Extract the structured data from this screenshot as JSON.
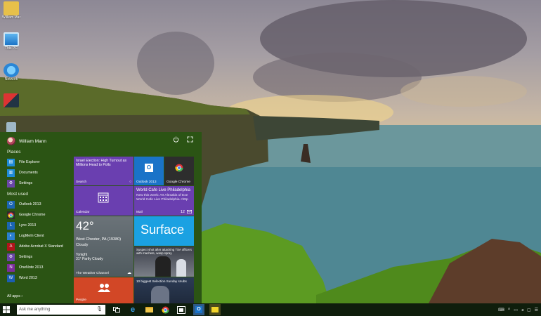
{
  "desktop": {
    "icons": [
      {
        "label": "William Mann",
        "icon": "user-folder-icon"
      },
      {
        "label": "This PC",
        "icon": "computer-icon"
      },
      {
        "label": "Network",
        "icon": "network-icon"
      },
      {
        "label": "",
        "icon": "app-icon"
      },
      {
        "label": "",
        "icon": "recycle-bin-icon"
      }
    ]
  },
  "start_menu": {
    "user_name": "William Mann",
    "places_header": "Places",
    "places": [
      {
        "label": "File Explorer",
        "icon": "folder-icon",
        "color": "#1f8bd8"
      },
      {
        "label": "Documents",
        "icon": "documents-icon",
        "color": "#1f8bd8"
      },
      {
        "label": "Settings",
        "icon": "gear-icon",
        "color": "#6a45a7"
      }
    ],
    "most_used_header": "Most used",
    "most_used": [
      {
        "label": "Outlook 2013",
        "icon": "outlook-icon",
        "color": "#1b65b3"
      },
      {
        "label": "Google Chrome",
        "icon": "chrome-icon",
        "color": "#2d2d2d"
      },
      {
        "label": "Lync 2013",
        "icon": "lync-icon",
        "color": "#1b65b3"
      },
      {
        "label": "LogMeIn Client",
        "icon": "logmein-icon",
        "color": "#2a7fd0"
      },
      {
        "label": "Adobe Acrobat X Standard",
        "icon": "acrobat-icon",
        "color": "#b3141b"
      },
      {
        "label": "Settings",
        "icon": "gear-icon",
        "color": "#6a45a7"
      },
      {
        "label": "OneNote 2013",
        "icon": "onenote-icon",
        "color": "#7b2d9a"
      },
      {
        "label": "Word 2013",
        "icon": "word-icon",
        "color": "#1b5eb3"
      }
    ],
    "all_apps": "All apps",
    "tiles": {
      "search": {
        "headline": "Israel Election: High Turnout as Millions Head to Polls",
        "label": "Search",
        "color": "#6a3fb0"
      },
      "outlook": {
        "label": "Outlook 2013",
        "color": "#1a73c8"
      },
      "chrome": {
        "label": "Google Chrome",
        "color": "#2d2d2d"
      },
      "calendar": {
        "label": "Calendar",
        "color": "#6a3fb0"
      },
      "mail": {
        "title": "World Cafe Live Philadelphia",
        "body": "New this week: Art Alexakis of Exe World Cafe Live Philadelphia <http",
        "label": "Mail",
        "count": "12",
        "color": "#6a3fb0"
      },
      "weather": {
        "temp": "42°",
        "city": "West Chester, PA (19380)",
        "condition": "Cloudy",
        "forecast_day": "Tonight",
        "forecast": "31° Partly Cloudy",
        "label": "The Weather Channel"
      },
      "surface": {
        "text": "Surface",
        "color": "#1ba1e2"
      },
      "news": {
        "text": "Suspect shot after attacking TSA officers with machete, wasp spray"
      },
      "people": {
        "label": "People",
        "color": "#d24726"
      },
      "video": {
        "text": "10 biggest Selection Sunday snubs"
      }
    }
  },
  "taskbar": {
    "search_placeholder": "Ask me anything",
    "apps": [
      "task-view-icon",
      "edge-icon",
      "file-explorer-icon",
      "chrome-icon",
      "store-icon",
      "outlook-icon",
      "sticky-icon"
    ],
    "tray": [
      "keyboard-icon",
      "up-arrow-icon",
      "network-icon",
      "volume-icon",
      "message-icon",
      "notification-icon"
    ]
  }
}
